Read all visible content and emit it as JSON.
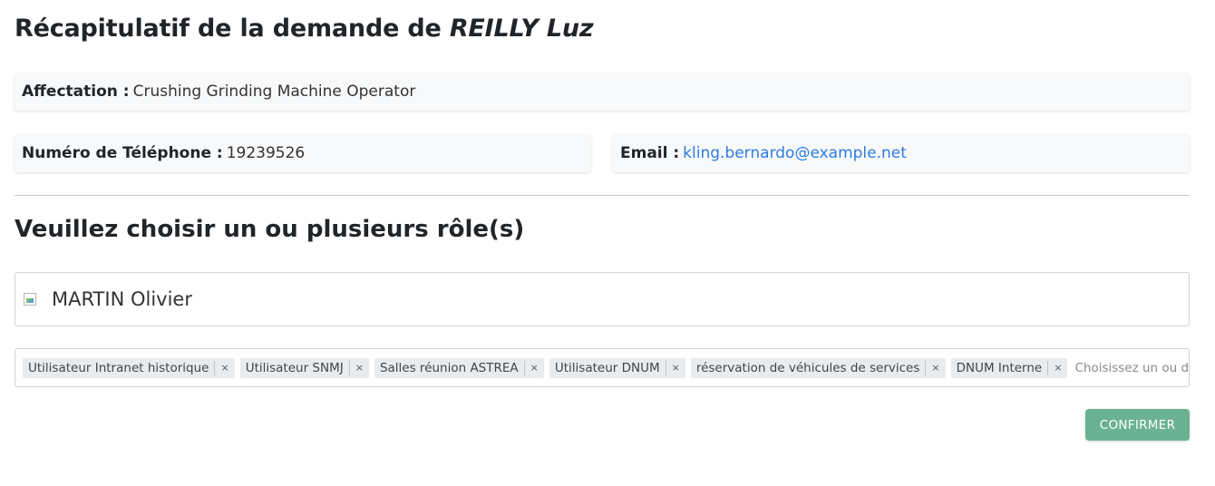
{
  "header": {
    "title_prefix": "Récapitulatif de la demande de",
    "title_name": "REILLY Luz"
  },
  "summary": {
    "affectation_label": "Affectation :",
    "affectation_value": "Crushing Grinding Machine Operator",
    "phone_label": "Numéro de Téléphone :",
    "phone_value": "19239526",
    "email_label": "Email :",
    "email_value": "kling.bernardo@example.net"
  },
  "roles_section": {
    "title": "Veuillez choisir un ou plusieurs rôle(s)",
    "selected_user": "MARTIN Olivier",
    "selected_roles": [
      {
        "label": "Utilisateur Intranet historique",
        "remove": "×"
      },
      {
        "label": "Utilisateur SNMJ",
        "remove": "×"
      },
      {
        "label": "Salles réunion ASTREA",
        "remove": "×"
      },
      {
        "label": "Utilisateur DNUM",
        "remove": "×"
      },
      {
        "label": "réservation de véhicules de services",
        "remove": "×"
      },
      {
        "label": "DNUM Interne",
        "remove": "×"
      }
    ],
    "roles_placeholder": "Choisissez un ou des rôle(s)"
  },
  "actions": {
    "confirm_label": "CONFIRMER"
  },
  "colors": {
    "link": "#2c7be5",
    "confirm_button": "#6bb292",
    "card_background": "#f8f9fa"
  },
  "icons": {
    "user_avatar": "broken-image-icon",
    "tag_remove": "close-icon"
  }
}
